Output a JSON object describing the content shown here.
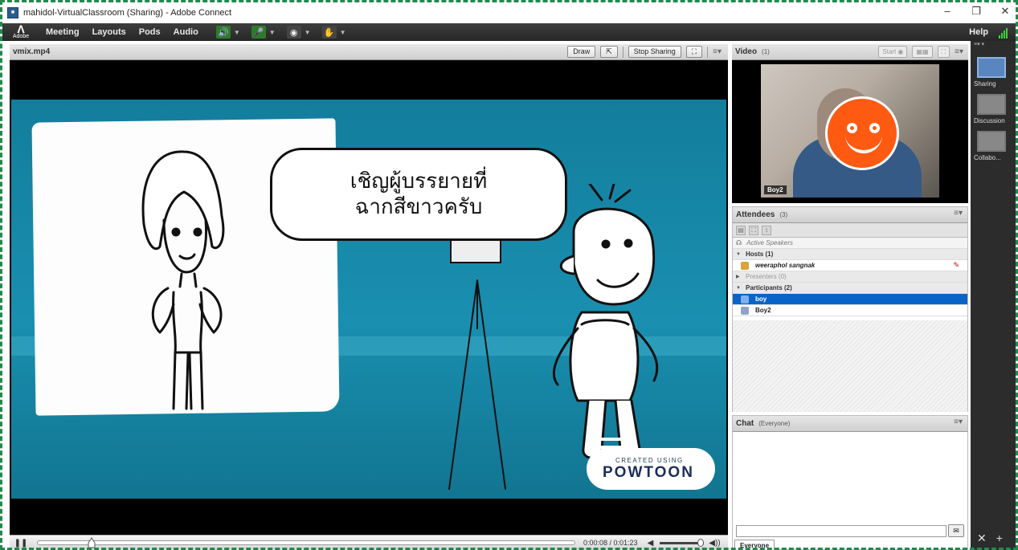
{
  "window": {
    "title": "mahidol-VirtualClassroom (Sharing) - Adobe Connect",
    "controls": [
      "–",
      "❐",
      "✕"
    ]
  },
  "menubar": {
    "logo": "Adobe",
    "items": [
      "Meeting",
      "Layouts",
      "Pods",
      "Audio"
    ],
    "help": "Help"
  },
  "share_pod": {
    "title": "vmix.mp4",
    "draw": "Draw",
    "stop_sharing": "Stop Sharing",
    "bubble_line1": "เชิญผู้บรรยายที่",
    "bubble_line2": "ฉากสีขาวครับ",
    "brand_small": "CREATED USING",
    "brand_big": "POWTOON",
    "time": "0:00:08 / 0:01:23",
    "progress": 0.1
  },
  "video_pod": {
    "title": "Video",
    "count": "(1)",
    "start": "Start",
    "cam_label": "Boy2"
  },
  "attendees": {
    "title": "Attendees",
    "count": "(3)",
    "active_speakers": "Active Speakers",
    "hosts": "Hosts (1)",
    "host_name": "weeraphol sangnak",
    "presenters": "Presenters (0)",
    "participants": "Participants (2)",
    "participant_1": "boy",
    "participant_2": "Boy2"
  },
  "chat": {
    "title": "Chat",
    "scope": "(Everyone)",
    "tab": "Everyone"
  },
  "layouts": {
    "items": [
      "Sharing",
      "Discussion",
      "Collabo..."
    ]
  },
  "colors": {
    "accent_select": "#0a64c8",
    "avatar_smiley": "#ff5a12",
    "stage_bg": "#1a8fb0"
  }
}
